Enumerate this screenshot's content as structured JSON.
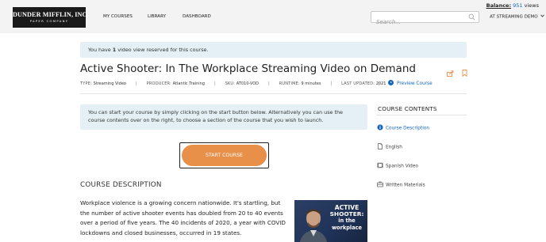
{
  "balance": {
    "label": "Balance:",
    "amount": "951",
    "unit": "views"
  },
  "header": {
    "logo": {
      "line1": "DUNDER MIFFLIN, INC",
      "line2": "PAPER COMPANY"
    },
    "nav": [
      "MY COURSES",
      "LIBRARY",
      "DASHBOARD"
    ],
    "search_placeholder": "Search...",
    "account": "AT STREAMING DEMO"
  },
  "notice": {
    "prefix": "You have ",
    "count": "1",
    "suffix": " video view reserved for this course."
  },
  "course": {
    "title": "Active Shooter: In The Workplace Streaming Video on Demand",
    "meta": [
      {
        "key": "TYPE:",
        "value": "Streaming Video"
      },
      {
        "key": "PRODUCER:",
        "value": "Atlantic Training"
      },
      {
        "key": "SKU:",
        "value": "AT010-VOD"
      },
      {
        "key": "RUNTIME:",
        "value": "9 minutes"
      },
      {
        "key": "LAST UPDATED:",
        "value": "2021"
      }
    ],
    "preview_label": "Preview Course",
    "instructions": "You can start your course by simply clicking on the start button below. Alternatively you can use the course contents over on the right, to choose a section of the course that you wish to launch.",
    "start_label": "START COURSE",
    "description_heading": "COURSE DESCRIPTION",
    "description": "Workplace violence is a growing concern nationwide. It's startling, but the number of active shooter events has doubled from 20 to 40 events over a period of five years. The 40 incidents of 2020, a year with COVID lockdowns and closed businesses, occurred in 19 states.",
    "thumbnail": {
      "line1": "ACTIVE",
      "line2": "SHOOTER:",
      "line3": "in the",
      "line4": "workplace"
    }
  },
  "contents": {
    "title": "COURSE CONTENTS",
    "items": [
      {
        "label": "Course Description",
        "icon": "info-icon"
      },
      {
        "label": "English",
        "icon": "document-icon"
      },
      {
        "label": "Spanish Video",
        "icon": "film-icon"
      },
      {
        "label": "Written Materials",
        "icon": "briefcase-icon"
      }
    ]
  },
  "colors": {
    "accent": "#1565c0",
    "start_button": "#e8904a",
    "notice_bg": "#e4f0f5",
    "header_bg": "#f3f3f3"
  }
}
